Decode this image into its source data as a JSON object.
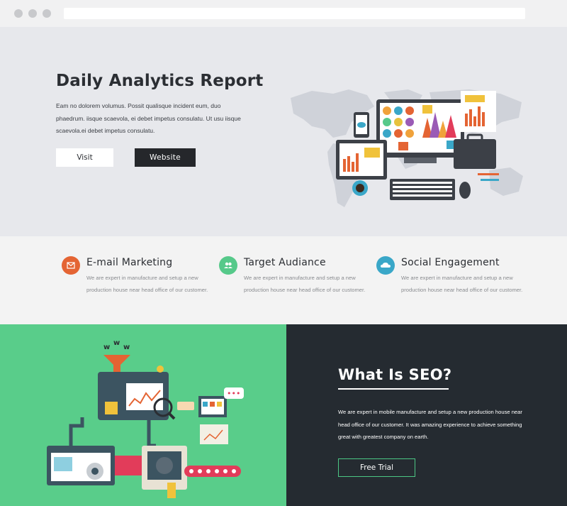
{
  "hero": {
    "title": "Daily Analytics Report",
    "text": "Eam no dolorem volumus. Possit qualisque incident eum, duo phaedrum. iisque scaevola, ei debet impetus consulatu. Ut usu iisque scaevola.ei debet impetus consulatu.",
    "visit_label": "Visit",
    "website_label": "Website"
  },
  "features": [
    {
      "title": "E-mail Marketing",
      "text": "We are expert in manufacture and setup a new production house near head office of our customer.",
      "icon": "envelope-icon",
      "color": "#e46433"
    },
    {
      "title": "Target Audiance",
      "text": "We are expert in manufacture and setup a new production house near head office of our customer.",
      "icon": "users-icon",
      "color": "#56c98a"
    },
    {
      "title": "Social Engagement",
      "text": "We are expert in manufacture and setup a new production house near head office of our customer.",
      "icon": "cloud-icon",
      "color": "#3aa7c8"
    }
  ],
  "seo": {
    "title": "What Is SEO?",
    "text": "We are expert in mobile manufacture and setup a new production house near head office of our customer. It was amazing experience to achieve something great with greatest company on earth.",
    "button_label": "Free Trial"
  },
  "illustration": {
    "speech_bubble": "•••",
    "funnel_letters": [
      "w",
      "w",
      "w"
    ]
  },
  "colors": {
    "hero_bg": "#e7e8ec",
    "features_bg": "#f3f3f3",
    "green": "#59cd8a",
    "dark": "#252b31"
  }
}
